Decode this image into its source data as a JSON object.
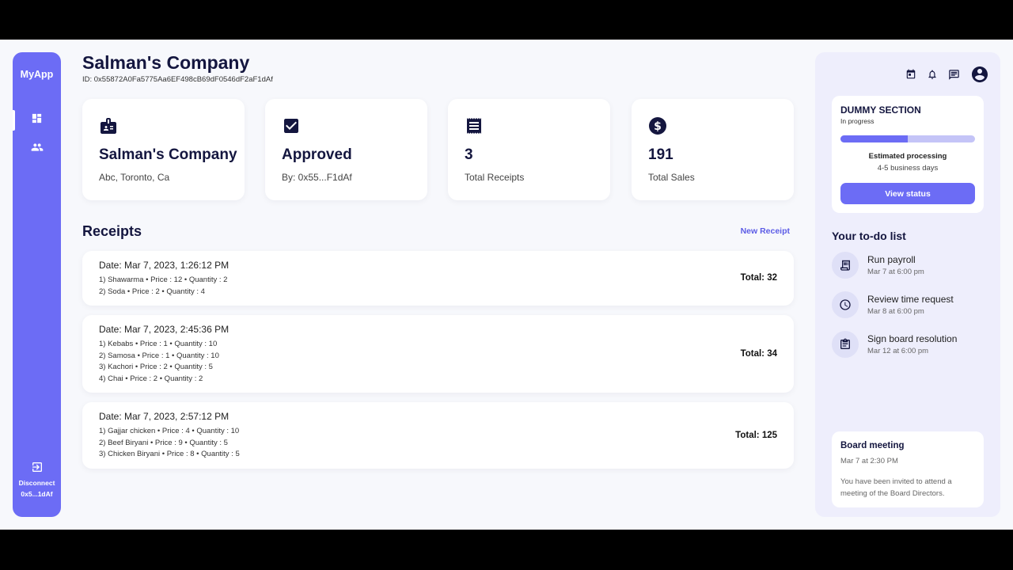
{
  "app": {
    "name": "MyApp"
  },
  "sidebar": {
    "items": [
      {
        "icon": "dashboard-icon",
        "active": true
      },
      {
        "icon": "users-icon",
        "active": false
      }
    ],
    "disconnect_label": "Disconnect",
    "address_short": "0x5...1dAf"
  },
  "header": {
    "title": "Salman's Company",
    "id_text": "ID: 0x55872A0Fa5775Aa6EF498cB69dF0546dF2aF1dAf"
  },
  "cards": [
    {
      "icon": "badge-icon",
      "value": "Salman's Company",
      "sub": "Abc, Toronto, Ca"
    },
    {
      "icon": "checkbox-icon",
      "value": "Approved",
      "sub": "By: 0x55...F1dAf"
    },
    {
      "icon": "receipt-icon",
      "value": "3",
      "sub": "Total Receipts"
    },
    {
      "icon": "dollar-icon",
      "value": "191",
      "sub": "Total Sales"
    }
  ],
  "receipts_section": {
    "title": "Receipts",
    "new_label": "New Receipt",
    "receipts": [
      {
        "date": "Date: Mar 7, 2023, 1:26:12 PM",
        "items": [
          "1) Shawarma • Price : 12 • Quantity : 2",
          "2) Soda • Price : 2 • Quantity : 4"
        ],
        "total": "Total: 32"
      },
      {
        "date": "Date: Mar 7, 2023, 2:45:36 PM",
        "items": [
          "1) Kebabs • Price : 1 • Quantity : 10",
          "2) Samosa • Price : 1 • Quantity : 10",
          "3) Kachori • Price : 2 • Quantity : 5",
          "4) Chai • Price : 2 • Quantity : 2"
        ],
        "total": "Total: 34"
      },
      {
        "date": "Date: Mar 7, 2023, 2:57:12 PM",
        "items": [
          "1) Gajjar chicken • Price : 4 • Quantity : 10",
          "2) Beef Biryani • Price : 9 • Quantity : 5",
          "3) Chicken Biryani • Price : 8 • Quantity : 5"
        ],
        "total": "Total: 125"
      }
    ]
  },
  "right_panel": {
    "top_icons": [
      "calendar-icon",
      "bell-icon",
      "chat-icon",
      "account-icon"
    ],
    "dummy": {
      "title": "DUMMY SECTION",
      "status": "In progress",
      "progress_fraction": 0.5,
      "estimate_label": "Estimated processing",
      "estimate_value": "4-5 business days",
      "button_label": "View status"
    },
    "todo": {
      "title": "Your to-do list",
      "items": [
        {
          "icon": "receipt-icon",
          "label": "Run payroll",
          "time": "Mar 7 at 6:00 pm"
        },
        {
          "icon": "clock-icon",
          "label": "Review time request",
          "time": "Mar 8 at 6:00 pm"
        },
        {
          "icon": "clipboard-icon",
          "label": "Sign board resolution",
          "time": "Mar 12 at 6:00 pm"
        }
      ]
    },
    "meeting": {
      "title": "Board meeting",
      "time": "Mar 7 at 2:30 PM",
      "description": "You have been invited to attend a meeting of the Board Directors."
    }
  },
  "colors": {
    "accent": "#6c6cf5",
    "accent_light": "#c4c4f7",
    "navy": "#14163f",
    "background": "#f7f8fc",
    "panel": "#eeeefc"
  }
}
